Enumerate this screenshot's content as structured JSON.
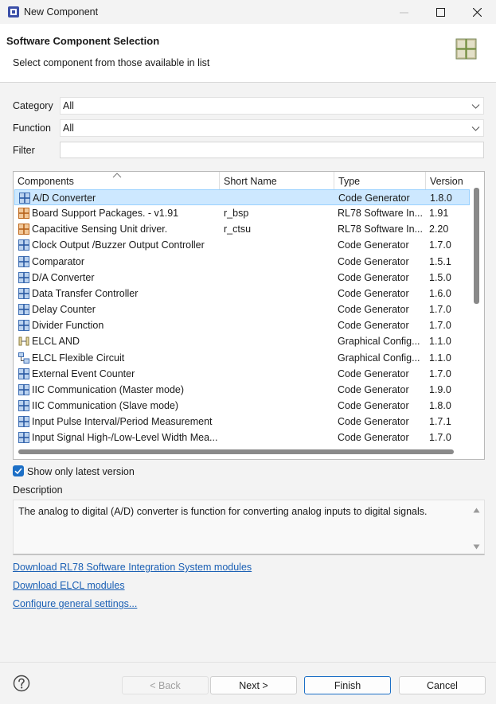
{
  "window": {
    "title": "New Component"
  },
  "header": {
    "title": "Software Component Selection",
    "subtitle": "Select component from those available in list"
  },
  "form": {
    "category_label": "Category",
    "category_value": "All",
    "function_label": "Function",
    "function_value": "All",
    "filter_label": "Filter",
    "filter_value": ""
  },
  "table": {
    "columns": [
      "Components",
      "Short Name",
      "Type",
      "Version"
    ],
    "rows": [
      {
        "name": "A/D Converter",
        "short": "",
        "type": "Code Generator",
        "version": "1.8.0",
        "icon": "code-generator-icon",
        "selected": true
      },
      {
        "name": "Board Support Packages. - v1.91",
        "short": "r_bsp",
        "type": "RL78 Software In...",
        "version": "1.91",
        "icon": "software-integration-icon"
      },
      {
        "name": "Capacitive Sensing Unit driver.",
        "short": "r_ctsu",
        "type": "RL78 Software In...",
        "version": "2.20",
        "icon": "software-integration-icon"
      },
      {
        "name": "Clock Output /Buzzer Output Controller",
        "short": "",
        "type": "Code Generator",
        "version": "1.7.0",
        "icon": "code-generator-icon"
      },
      {
        "name": "Comparator",
        "short": "",
        "type": "Code Generator",
        "version": "1.5.1",
        "icon": "code-generator-icon"
      },
      {
        "name": "D/A Converter",
        "short": "",
        "type": "Code Generator",
        "version": "1.5.0",
        "icon": "code-generator-icon"
      },
      {
        "name": "Data Transfer Controller",
        "short": "",
        "type": "Code Generator",
        "version": "1.6.0",
        "icon": "code-generator-icon"
      },
      {
        "name": "Delay Counter",
        "short": "",
        "type": "Code Generator",
        "version": "1.7.0",
        "icon": "code-generator-icon"
      },
      {
        "name": "Divider Function",
        "short": "",
        "type": "Code Generator",
        "version": "1.7.0",
        "icon": "code-generator-icon"
      },
      {
        "name": "ELCL AND",
        "short": "",
        "type": "Graphical Config...",
        "version": "1.1.0",
        "icon": "logic-gate-icon"
      },
      {
        "name": "ELCL Flexible Circuit",
        "short": "",
        "type": "Graphical Config...",
        "version": "1.1.0",
        "icon": "flexible-circuit-icon"
      },
      {
        "name": "External Event Counter",
        "short": "",
        "type": "Code Generator",
        "version": "1.7.0",
        "icon": "code-generator-icon"
      },
      {
        "name": "IIC Communication (Master mode)",
        "short": "",
        "type": "Code Generator",
        "version": "1.9.0",
        "icon": "code-generator-icon"
      },
      {
        "name": "IIC Communication (Slave mode)",
        "short": "",
        "type": "Code Generator",
        "version": "1.8.0",
        "icon": "code-generator-icon"
      },
      {
        "name": "Input Pulse Interval/Period Measurement",
        "short": "",
        "type": "Code Generator",
        "version": "1.7.1",
        "icon": "code-generator-icon"
      },
      {
        "name": "Input Signal High-/Low-Level Width Mea...",
        "short": "",
        "type": "Code Generator",
        "version": "1.7.0",
        "icon": "code-generator-icon"
      }
    ]
  },
  "options": {
    "latest_only_label": "Show only latest version",
    "latest_only_checked": true
  },
  "description": {
    "label": "Description",
    "text": "The analog to digital (A/D) converter is function for converting analog inputs to digital signals."
  },
  "links": {
    "rl78": "Download RL78 Software Integration System modules",
    "elcl": "Download ELCL modules",
    "settings": "Configure general settings..."
  },
  "buttons": {
    "back": "< Back",
    "next": "Next >",
    "finish": "Finish",
    "cancel": "Cancel"
  },
  "colors": {
    "accent": "#1c6fc6",
    "selection": "#cde8ff",
    "link": "#1a5fb4"
  }
}
